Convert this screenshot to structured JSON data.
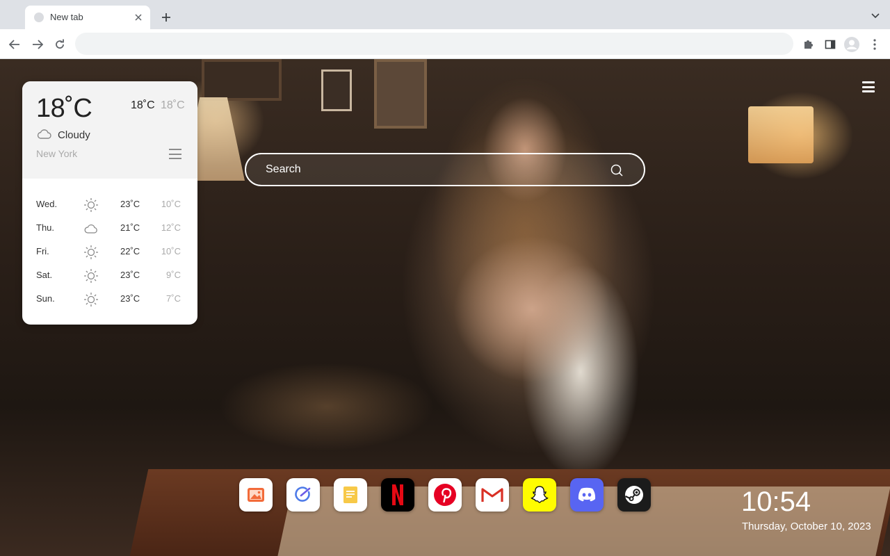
{
  "browser": {
    "tab_title": "New tab",
    "address_value": "",
    "address_placeholder": ""
  },
  "weather": {
    "current_temp": "18˚C",
    "high": "18˚C",
    "low": "18˚C",
    "condition": "Cloudy",
    "condition_icon": "cloud-icon",
    "city": "New York",
    "forecast": [
      {
        "day": "Wed.",
        "icon": "sun-icon",
        "high": "23˚C",
        "low": "10˚C"
      },
      {
        "day": "Thu.",
        "icon": "cloud-icon",
        "high": "21˚C",
        "low": "12˚C"
      },
      {
        "day": "Fri.",
        "icon": "sun-icon",
        "high": "22˚C",
        "low": "10˚C"
      },
      {
        "day": "Sat.",
        "icon": "sun-icon",
        "high": "23˚C",
        "low": "9˚C"
      },
      {
        "day": "Sun.",
        "icon": "sun-icon",
        "high": "23˚C",
        "low": "7˚C"
      }
    ]
  },
  "search": {
    "placeholder": "Search"
  },
  "dock": {
    "apps": [
      {
        "name": "photos-icon",
        "color": "#ffffff"
      },
      {
        "name": "tasks-check-icon",
        "color": "#ffffff"
      },
      {
        "name": "notes-icon",
        "color": "#ffffff"
      },
      {
        "name": "netflix-icon",
        "color": "#000000",
        "letter": "N"
      },
      {
        "name": "pinterest-icon",
        "color": "#ffffff",
        "letter": "P"
      },
      {
        "name": "gmail-icon",
        "color": "#ffffff",
        "letter": "M"
      },
      {
        "name": "snapchat-icon",
        "color": "#fffc00"
      },
      {
        "name": "discord-icon",
        "color": "#5865f2"
      },
      {
        "name": "steam-icon",
        "color": "#1b1b1b"
      }
    ]
  },
  "clock": {
    "time": "10:54",
    "date": "Thursday, October 10, 2023"
  },
  "colors": {
    "tabstrip": "#dee1e6",
    "accent_netflix": "#e50914",
    "accent_pinterest": "#e60023",
    "accent_discord": "#5865f2",
    "accent_snapchat": "#fffc00"
  }
}
